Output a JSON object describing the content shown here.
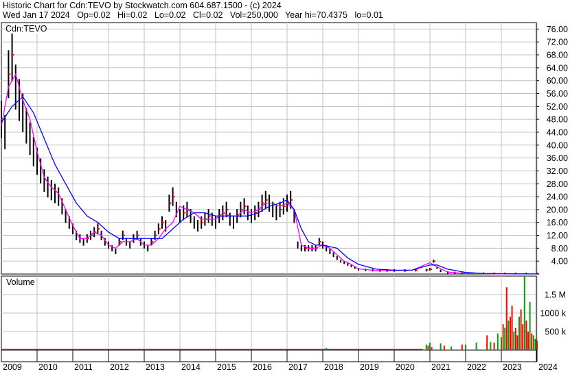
{
  "header": {
    "title": "Historic Chart for Cdn:TEVO by Stockwatch.com 604.687.1500 - (c) 2024",
    "date": "Wed Jan 17 2024",
    "open": "Op=0.02",
    "high": "Hi=0.02",
    "low": "Lo=0.02",
    "close": "Cl=0.02",
    "volume": "Vol=250,000",
    "year_high": "Year hi=70.4375",
    "year_low": "lo=0.01"
  },
  "price_panel": {
    "label": "Cdn:TEVO"
  },
  "volume_panel": {
    "label": "Volume"
  },
  "colors": {
    "price_bars": "#000000",
    "up_ticks": "#ff0000",
    "short_ma": "#ff00ff",
    "long_ma": "#0000ff",
    "volume_up": "#00a000",
    "volume_down": "#ff0000",
    "grid": "#c0c0c0"
  },
  "chart_data": [
    {
      "type": "line",
      "panel": "price",
      "y_ticks": [
        "76.00",
        "72.00",
        "68.00",
        "64.00",
        "60.00",
        "56.00",
        "52.00",
        "48.00",
        "44.00",
        "40.00",
        "36.00",
        "32.00",
        "28.00",
        "24.00",
        "20.00",
        "16.00",
        "12.00",
        "8.00",
        "4.00"
      ],
      "ylim": [
        0,
        78
      ],
      "x_ticks": [
        "2009",
        "2010",
        "2011",
        "2012",
        "2013",
        "2014",
        "2015",
        "2016",
        "2017",
        "2018",
        "2019",
        "2020",
        "2021",
        "2022",
        "2023",
        "2024"
      ],
      "grid": true,
      "series": [
        {
          "role": "close",
          "x": [
            2009.0,
            2009.1,
            2009.2,
            2009.3,
            2009.4,
            2009.5,
            2009.6,
            2009.7,
            2009.8,
            2009.9,
            2010.0,
            2010.1,
            2010.2,
            2010.3,
            2010.4,
            2010.5,
            2010.6,
            2010.7,
            2010.8,
            2010.9,
            2011.0,
            2011.1,
            2011.2,
            2011.3,
            2011.4,
            2011.5,
            2011.6,
            2011.7,
            2011.8,
            2011.9,
            2012.0,
            2012.1,
            2012.2,
            2012.3,
            2012.4,
            2012.5,
            2012.6,
            2012.7,
            2012.8,
            2012.9,
            2013.0,
            2013.1,
            2013.2,
            2013.3,
            2013.4,
            2013.5,
            2013.6,
            2013.7,
            2013.8,
            2013.9,
            2014.0,
            2014.1,
            2014.2,
            2014.3,
            2014.4,
            2014.5,
            2014.6,
            2014.7,
            2014.8,
            2014.9,
            2015.0,
            2015.1,
            2015.2,
            2015.3,
            2015.4,
            2015.5,
            2015.6,
            2015.7,
            2015.8,
            2015.9,
            2016.0,
            2016.1,
            2016.2,
            2016.3,
            2016.4,
            2016.5,
            2016.6,
            2016.7,
            2016.8,
            2016.9,
            2017.0,
            2017.1,
            2017.2,
            2017.3,
            2017.4,
            2017.5,
            2017.6,
            2017.7,
            2017.8,
            2017.9,
            2018.0,
            2018.1,
            2018.2,
            2018.3,
            2018.4,
            2018.5,
            2018.6,
            2018.7,
            2018.8,
            2018.9,
            2019.0,
            2019.2,
            2019.4,
            2019.6,
            2019.8,
            2020.0,
            2020.3,
            2020.6,
            2020.9,
            2021.0,
            2021.1,
            2021.2,
            2021.3,
            2021.5,
            2021.7,
            2021.9,
            2022.2,
            2022.5,
            2022.8,
            2023.1,
            2023.4,
            2023.7,
            2024.0
          ],
          "values": [
            48,
            44,
            62,
            68,
            58,
            54,
            50,
            46,
            42,
            38,
            35,
            32,
            29,
            27,
            26,
            25,
            24,
            21,
            18,
            16,
            14,
            12,
            11,
            10,
            11,
            12,
            13,
            14,
            12,
            10,
            9,
            8,
            7,
            10,
            12,
            10,
            9,
            11,
            12,
            10,
            9,
            8,
            10,
            12,
            14,
            16,
            15,
            22,
            24,
            20,
            18,
            19,
            20,
            18,
            16,
            15,
            16,
            17,
            18,
            17,
            16,
            18,
            19,
            20,
            17,
            16,
            18,
            20,
            21,
            19,
            18,
            19,
            20,
            22,
            23,
            22,
            20,
            19,
            20,
            21,
            22,
            23,
            18,
            9,
            8,
            8,
            8,
            8,
            8,
            10,
            9,
            8,
            7,
            6,
            5,
            4,
            3.5,
            3,
            2.5,
            2,
            1.5,
            1.3,
            1.2,
            1.1,
            1.1,
            1.1,
            1.1,
            1.2,
            1.2,
            1.5,
            4,
            2,
            1,
            0.5,
            0.3,
            0.2,
            0.1,
            0.08,
            0.05,
            0.04,
            0.03,
            0.02,
            0.02
          ]
        },
        {
          "role": "short_ma",
          "x": [
            2009.0,
            2009.2,
            2009.4,
            2009.6,
            2009.8,
            2010.0,
            2010.2,
            2010.4,
            2010.6,
            2010.8,
            2011.0,
            2011.2,
            2011.4,
            2011.6,
            2011.8,
            2012.0,
            2012.2,
            2012.4,
            2012.6,
            2012.8,
            2013.0,
            2013.2,
            2013.4,
            2013.6,
            2013.8,
            2014.0,
            2014.2,
            2014.4,
            2014.6,
            2014.8,
            2015.0,
            2015.2,
            2015.4,
            2015.6,
            2015.8,
            2016.0,
            2016.2,
            2016.4,
            2016.6,
            2016.8,
            2017.0,
            2017.2,
            2017.4,
            2017.6,
            2017.8,
            2018.0,
            2018.2,
            2018.4,
            2018.6,
            2018.8,
            2019.0,
            2019.5,
            2020.0,
            2020.5,
            2021.0,
            2021.2,
            2021.5,
            2022.0,
            2022.5,
            2023.0,
            2023.5,
            2024.0
          ],
          "values": [
            46,
            58,
            62,
            54,
            48,
            38,
            30,
            27,
            25,
            20,
            15,
            11,
            11,
            13,
            12,
            9,
            8,
            10,
            10,
            11,
            9,
            9,
            11,
            14,
            16,
            21,
            20,
            19,
            17,
            17,
            17,
            19,
            18,
            18,
            20,
            19,
            20,
            22,
            22,
            21,
            22,
            20,
            9,
            8,
            8,
            9,
            8,
            6,
            4,
            3,
            1.6,
            1.1,
            1.1,
            1.2,
            3.5,
            2.2,
            0.6,
            0.2,
            0.1,
            0.05,
            0.03,
            0.02
          ]
        },
        {
          "role": "long_ma",
          "x": [
            2009.0,
            2009.3,
            2009.6,
            2009.9,
            2010.2,
            2010.5,
            2010.8,
            2011.1,
            2011.4,
            2011.7,
            2012.0,
            2012.3,
            2012.6,
            2012.9,
            2013.2,
            2013.5,
            2013.8,
            2014.1,
            2014.4,
            2014.7,
            2015.0,
            2015.3,
            2015.6,
            2015.9,
            2016.2,
            2016.5,
            2016.8,
            2017.0,
            2017.2,
            2017.4,
            2017.6,
            2017.8,
            2018.0,
            2018.2,
            2018.4,
            2018.7,
            2019.0,
            2019.5,
            2020.0,
            2020.5,
            2021.0,
            2021.2,
            2021.5,
            2022.0,
            2022.5,
            2023.0,
            2023.5,
            2024.0
          ],
          "values": [
            47,
            52,
            55,
            50,
            42,
            34,
            28,
            22,
            18,
            16,
            13,
            11,
            11,
            11,
            11,
            11,
            14,
            17,
            19,
            19,
            18,
            18,
            18,
            18,
            19,
            21,
            22,
            23,
            20,
            14,
            10,
            9,
            9,
            8.5,
            8,
            5,
            3,
            1.5,
            1.2,
            1.2,
            2.8,
            2.8,
            1.5,
            0.5,
            0.2,
            0.1,
            0.05,
            0.03
          ]
        }
      ]
    },
    {
      "type": "bar",
      "panel": "volume",
      "y_ticks": [
        "1.5 M",
        "1000 k",
        "500 k"
      ],
      "ylim": [
        0,
        2000000
      ],
      "x_ticks": [
        "2009",
        "2010",
        "2011",
        "2012",
        "2013",
        "2014",
        "2015",
        "2016",
        "2017",
        "2018",
        "2019",
        "2020",
        "2021",
        "2022",
        "2023",
        "2024"
      ],
      "series": [
        {
          "name": "up",
          "x": [
            2018.1,
            2020.9,
            2021.0,
            2021.3,
            2021.6,
            2022.0,
            2022.3,
            2022.7,
            2022.9,
            2023.0,
            2023.1,
            2023.2,
            2023.35,
            2023.5,
            2023.65,
            2023.8,
            2023.9,
            2023.95
          ],
          "values": [
            60000,
            150000,
            200000,
            180000,
            100000,
            150000,
            200000,
            220000,
            450000,
            350000,
            600000,
            800000,
            500000,
            900000,
            2000000,
            1300000,
            400000,
            300000
          ]
        },
        {
          "name": "down",
          "x": [
            2020.95,
            2021.05,
            2021.4,
            2021.9,
            2022.6,
            2022.8,
            2023.05,
            2023.15,
            2023.25,
            2023.3,
            2023.4,
            2023.45,
            2023.55,
            2023.6,
            2023.7,
            2023.75,
            2023.85,
            2024.0
          ],
          "values": [
            120000,
            80000,
            120000,
            150000,
            400000,
            200000,
            700000,
            1700000,
            900000,
            1200000,
            600000,
            400000,
            1100000,
            700000,
            800000,
            500000,
            450000,
            250000
          ]
        }
      ]
    }
  ]
}
